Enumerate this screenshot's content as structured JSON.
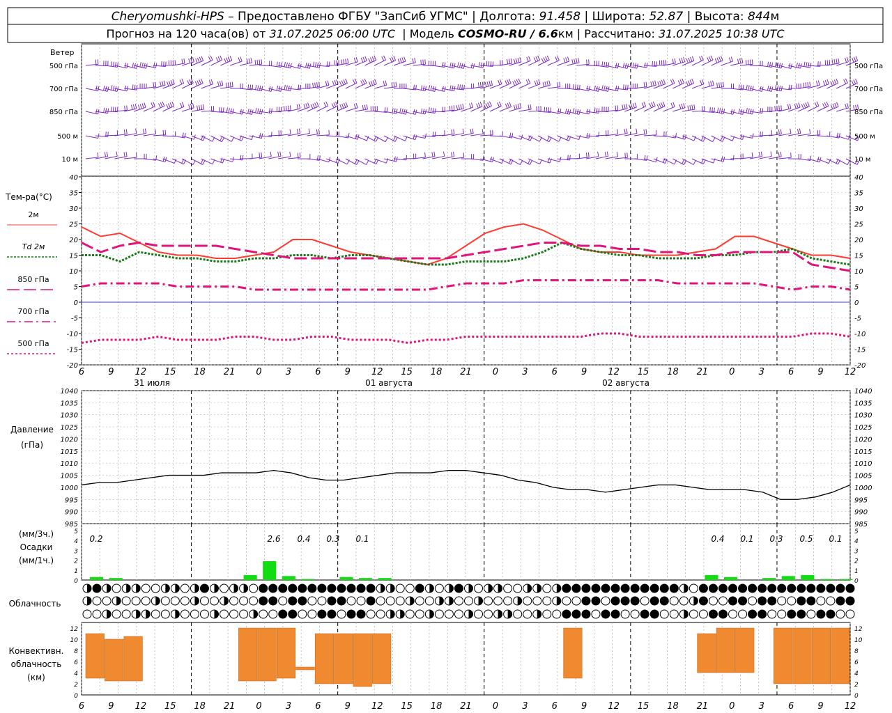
{
  "header": {
    "line1": [
      {
        "text": "Cheryomushki-HPS",
        "italic": true
      },
      {
        "text": " – Предоставлено ФГБУ \"ЗапСиб УГМС\" | Долгота: ",
        "italic": false
      },
      {
        "text": "91.458",
        "italic": true
      },
      {
        "text": " | Широта: ",
        "italic": false
      },
      {
        "text": "52.87",
        "italic": true
      },
      {
        "text": " | Высота: ",
        "italic": false
      },
      {
        "text": "844",
        "italic": true
      },
      {
        "text": "м",
        "italic": false
      }
    ],
    "line2": [
      {
        "text": "Прогноз на 120 часа(ов) от ",
        "italic": false
      },
      {
        "text": "31.07.2025 06:00 UTC",
        "italic": true
      },
      {
        "text": "  | Модель ",
        "italic": false
      },
      {
        "text": "COSMO-RU / 6.6",
        "italic": true,
        "bold": true
      },
      {
        "text": "км | Рассчитано: ",
        "italic": false
      },
      {
        "text": "31.07.2025 10:38 UTC",
        "italic": true
      }
    ]
  },
  "colors": {
    "t2m": "#ff3b30",
    "td2m": "#1a7a1a",
    "t850": "#e0157a",
    "t700": "#e0157a",
    "t500": "#e0157a",
    "zero": "#3333ff",
    "wind": "#7a2bbf",
    "pressure": "#000000",
    "precip": "#11dd11",
    "conv": "#f08a30"
  },
  "time_axis": {
    "hours": [
      "6",
      "9",
      "12",
      "15",
      "18",
      "21",
      "0",
      "3",
      "6",
      "9",
      "12",
      "15",
      "18",
      "21",
      "0",
      "3",
      "6",
      "9",
      "12",
      "15",
      "18",
      "21",
      "0",
      "3",
      "6",
      "9",
      "12"
    ],
    "dates": [
      "31 июля",
      "01 августа",
      "02 августа"
    ]
  },
  "wind": {
    "title": "Ветер",
    "levels": [
      "500 гПа",
      "700 гПа",
      "850 гПа",
      "500 м",
      "10  м"
    ]
  },
  "temperature": {
    "title": "Тем-ра(°C)",
    "legend": [
      "2м",
      "Td  2м",
      "850 гПа",
      "700 гПа",
      "500 гПа"
    ],
    "ticks": [
      "40",
      "35",
      "30",
      "25",
      "20",
      "15",
      "10",
      "5",
      "0",
      "-5",
      "-10",
      "-15",
      "-20"
    ]
  },
  "pressure": {
    "title_line1": "Давление",
    "title_line2": "(гПа)",
    "ticks": [
      "1040",
      "1035",
      "1030",
      "1025",
      "1020",
      "1015",
      "1010",
      "1005",
      "1000",
      "995",
      "990",
      "985"
    ]
  },
  "precip": {
    "title_line1": "(мм/3ч.)",
    "title_line2": "Осадки",
    "title_line3": "(мм/1ч.)",
    "ticks": [
      "5",
      "4",
      "3",
      "2",
      "1",
      "0"
    ],
    "totals": [
      "0.2",
      "2.6",
      "0.4",
      "0.3",
      "0.1",
      "0.4",
      "0.1",
      "0.3",
      "0.5",
      "0.1"
    ]
  },
  "clouds": {
    "title": "Облачность"
  },
  "convective": {
    "title_line1": "Конвективн.",
    "title_line2": "облачность",
    "title_line3": "(км)",
    "ticks": [
      "12",
      "10",
      "8",
      "6",
      "4",
      "2",
      "0"
    ]
  },
  "chart_data": [
    {
      "type": "line",
      "title": "Тем-ра(°C)",
      "x": [
        0,
        3,
        6,
        9,
        12,
        15,
        18,
        21,
        24,
        27,
        30,
        33,
        36,
        39,
        42,
        45,
        48,
        51,
        54,
        57,
        60,
        63,
        66,
        69,
        72,
        75,
        78,
        81,
        84,
        87,
        90,
        93,
        96,
        99,
        102,
        105,
        108,
        111,
        114,
        117,
        120
      ],
      "ylim": [
        -20,
        40
      ],
      "series": [
        {
          "name": "2м",
          "values": [
            24,
            21,
            22,
            19,
            16,
            15,
            15,
            14,
            14,
            15,
            16,
            20,
            20,
            18,
            16,
            15,
            14,
            13,
            12,
            14,
            18,
            22,
            24,
            25,
            23,
            20,
            17,
            16,
            16,
            15,
            15,
            15,
            16,
            17,
            21,
            21,
            19,
            17,
            15,
            15,
            14
          ]
        },
        {
          "name": "Td  2м",
          "values": [
            15,
            15,
            13,
            16,
            15,
            14,
            14,
            13,
            13,
            14,
            14,
            15,
            15,
            14,
            15,
            15,
            14,
            13,
            12,
            12,
            13,
            13,
            13,
            14,
            16,
            19,
            17,
            16,
            15,
            15,
            14,
            14,
            14,
            15,
            15,
            16,
            16,
            17,
            14,
            13,
            12
          ]
        },
        {
          "name": "850 гПа",
          "values": [
            19,
            16,
            18,
            19,
            18,
            18,
            18,
            18,
            17,
            16,
            15,
            14,
            14,
            14,
            14,
            14,
            14,
            14,
            14,
            14,
            15,
            16,
            17,
            18,
            19,
            19,
            18,
            18,
            17,
            17,
            16,
            16,
            15,
            15,
            16,
            16,
            16,
            16,
            12,
            11,
            10
          ]
        },
        {
          "name": "700 гПа",
          "values": [
            5,
            6,
            6,
            6,
            6,
            5,
            5,
            5,
            5,
            4,
            4,
            4,
            4,
            4,
            4,
            4,
            4,
            4,
            4,
            5,
            6,
            6,
            6,
            7,
            7,
            7,
            7,
            7,
            7,
            7,
            7,
            6,
            6,
            6,
            6,
            6,
            5,
            4,
            5,
            5,
            4
          ]
        },
        {
          "name": "500 гПа",
          "values": [
            -13,
            -12,
            -12,
            -12,
            -11,
            -12,
            -12,
            -12,
            -11,
            -11,
            -12,
            -12,
            -11,
            -11,
            -12,
            -12,
            -12,
            -13,
            -12,
            -12,
            -11,
            -11,
            -11,
            -11,
            -11,
            -11,
            -11,
            -10,
            -10,
            -11,
            -11,
            -11,
            -11,
            -11,
            -11,
            -11,
            -11,
            -11,
            -10,
            -10,
            -11
          ]
        }
      ]
    },
    {
      "type": "line",
      "title": "Давление",
      "x": [
        0,
        3,
        6,
        9,
        12,
        15,
        18,
        21,
        24,
        27,
        30,
        33,
        36,
        39,
        42,
        45,
        48,
        51,
        54,
        57,
        60,
        63,
        66,
        69,
        72,
        75,
        78,
        81,
        84,
        87,
        90,
        93,
        96,
        99,
        102,
        105,
        108,
        111,
        114,
        117,
        120
      ],
      "ylim": [
        985,
        1040
      ],
      "values": [
        1001,
        1002,
        1002,
        1003,
        1004,
        1005,
        1005,
        1005,
        1006,
        1006,
        1006,
        1007,
        1006,
        1004,
        1003,
        1003,
        1004,
        1005,
        1006,
        1006,
        1006,
        1007,
        1007,
        1006,
        1005,
        1003,
        1002,
        1000,
        999,
        999,
        998,
        999,
        1000,
        1001,
        1001,
        1000,
        999,
        999,
        999,
        998,
        995,
        995,
        996,
        998,
        1001
      ]
    },
    {
      "type": "bar",
      "title": "Осадки",
      "ylim": [
        0,
        5
      ],
      "x": [
        0,
        3,
        6,
        9,
        12,
        15,
        18,
        21,
        24,
        27,
        30,
        33,
        36,
        39,
        42,
        45,
        48,
        51,
        54,
        57,
        60,
        63,
        66,
        69,
        72,
        75,
        78,
        81,
        84,
        87,
        90,
        93,
        96,
        99,
        102,
        105,
        108,
        111,
        114,
        117
      ],
      "values": [
        0.3,
        0.2,
        0,
        0,
        0,
        0,
        0,
        0,
        0.5,
        1.9,
        0.4,
        0.1,
        0,
        0.3,
        0.2,
        0.2,
        0,
        0,
        0,
        0,
        0,
        0,
        0,
        0,
        0,
        0,
        0,
        0,
        0,
        0,
        0,
        0,
        0.5,
        0.3,
        0,
        0.2,
        0.4,
        0.5,
        0.1,
        0.1
      ]
    },
    {
      "type": "bar",
      "title": "Конвективн. облачность",
      "ylim": [
        0,
        12
      ],
      "x": [
        0,
        3,
        6,
        9,
        12,
        15,
        18,
        21,
        24,
        27,
        30,
        33,
        36,
        39,
        42,
        45,
        48,
        51,
        54,
        57,
        60,
        63,
        66,
        69,
        72,
        75,
        78,
        81,
        84,
        87,
        90,
        93,
        96,
        99,
        102,
        105,
        108,
        111,
        114,
        117
      ],
      "values": [
        [
          3,
          11
        ],
        [
          2.5,
          10
        ],
        [
          2.5,
          10.5
        ],
        [
          0,
          0
        ],
        [
          0,
          0
        ],
        [
          0,
          0
        ],
        [
          0,
          0
        ],
        [
          0,
          0
        ],
        [
          2.5,
          12
        ],
        [
          2.5,
          12
        ],
        [
          3,
          12
        ],
        [
          4.5,
          5
        ],
        [
          2,
          11
        ],
        [
          2,
          11
        ],
        [
          1.5,
          11
        ],
        [
          2,
          11
        ],
        [
          0,
          0
        ],
        [
          0,
          0
        ],
        [
          0,
          0
        ],
        [
          0,
          0
        ],
        [
          0,
          0
        ],
        [
          0,
          0
        ],
        [
          0,
          0
        ],
        [
          0,
          0
        ],
        [
          0,
          0
        ],
        [
          3,
          12
        ],
        [
          0,
          0
        ],
        [
          0,
          0
        ],
        [
          0,
          0
        ],
        [
          0,
          0
        ],
        [
          0,
          0
        ],
        [
          0,
          0
        ],
        [
          4,
          11
        ],
        [
          4,
          12
        ],
        [
          4,
          12
        ],
        [
          0,
          0
        ],
        [
          2,
          12
        ],
        [
          2,
          12
        ],
        [
          2,
          12
        ],
        [
          2,
          12
        ]
      ]
    }
  ]
}
